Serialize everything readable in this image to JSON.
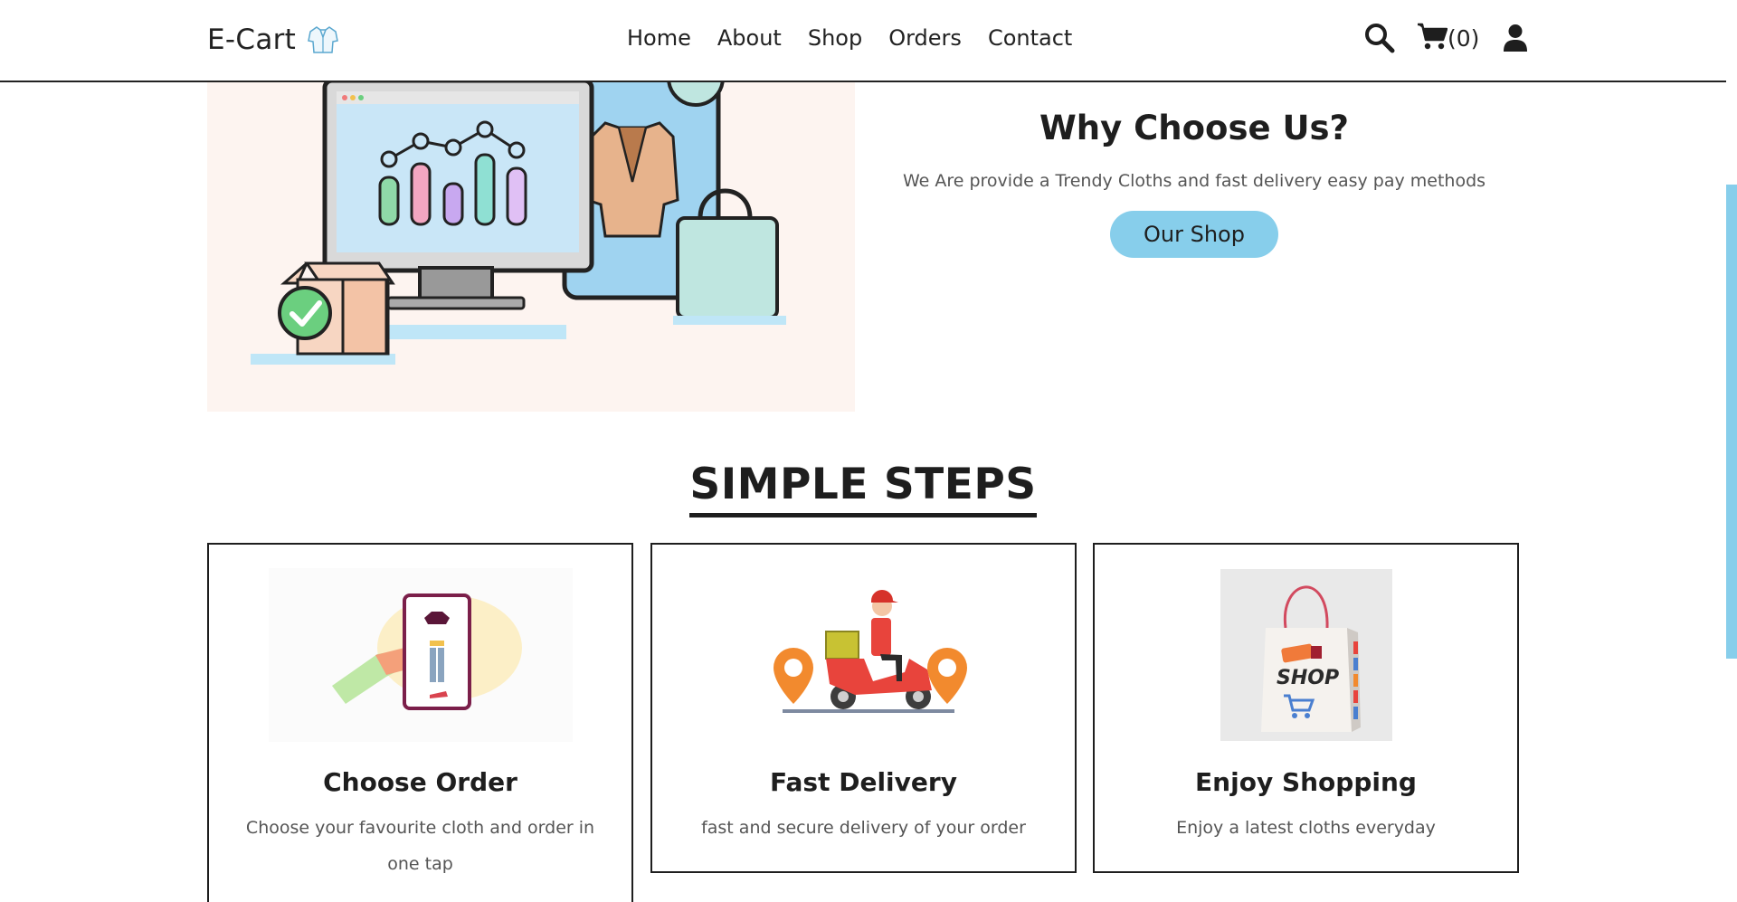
{
  "header": {
    "logo_text": "E-Cart",
    "nav": [
      "Home",
      "About",
      "Shop",
      "Orders",
      "Contact"
    ],
    "cart_count": "(0)",
    "icons": [
      "search-icon",
      "cart-icon",
      "user-icon"
    ]
  },
  "hero": {
    "title": "Why Choose Us?",
    "description": "We Are provide a Trendy Cloths and fast delivery easy pay methods",
    "button_label": "Our Shop"
  },
  "steps": {
    "title": "SIMPLE STEPS",
    "cards": [
      {
        "title": "Choose Order",
        "text": "Choose your favourite cloth and order in one tap"
      },
      {
        "title": "Fast Delivery",
        "text": "fast and secure delivery of your order"
      },
      {
        "title": "Enjoy Shopping",
        "text": "Enjoy a latest cloths everyday"
      }
    ],
    "bag_label": "SHOP"
  },
  "colors": {
    "accent": "#87ceeb",
    "text": "#1e1e1e",
    "muted": "#555555",
    "hero_bg": "#fdf4f0"
  }
}
